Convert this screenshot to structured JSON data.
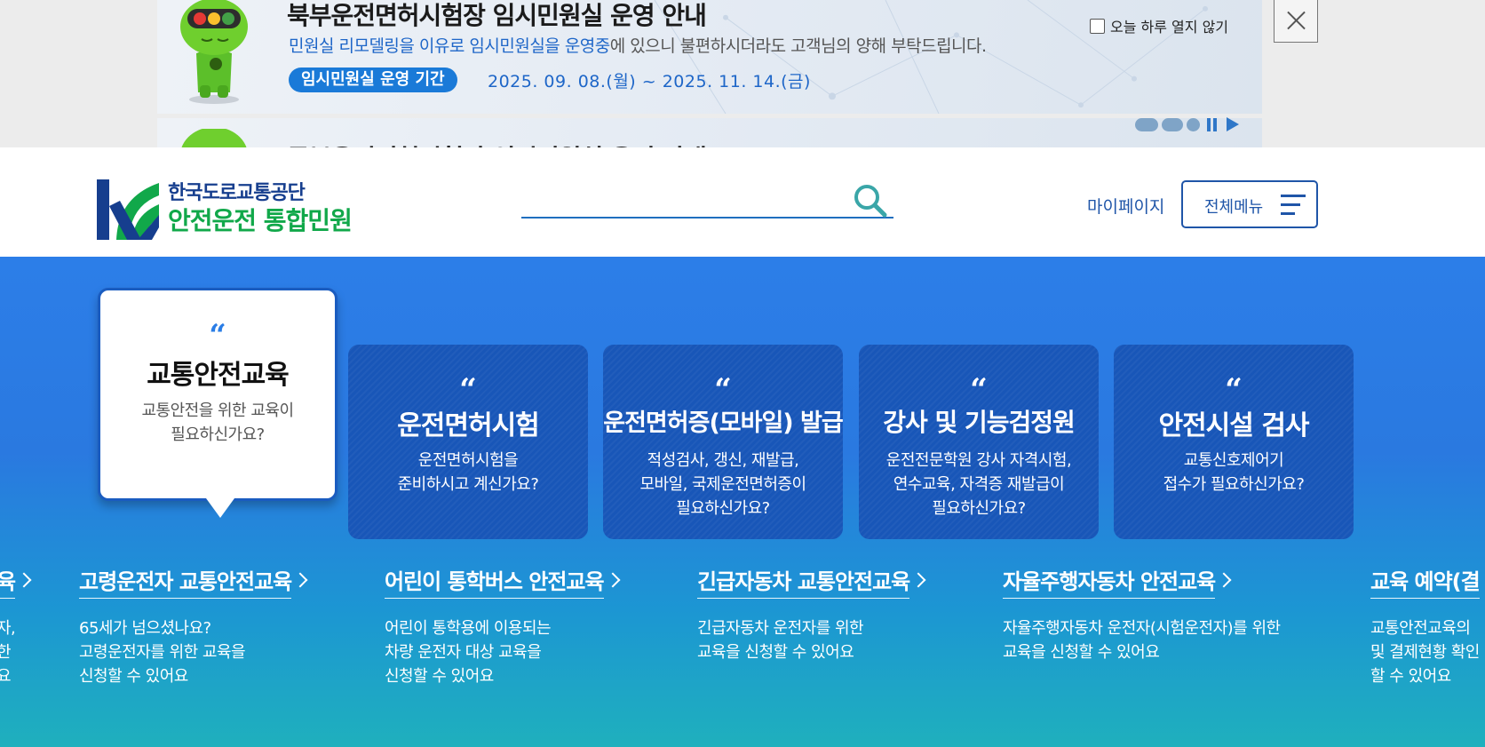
{
  "popup": {
    "slide1": {
      "title": "북부운전면허시험장 임시민원실 운영 안내",
      "desc_highlight": "민원실 리모델링을 이유로 임시민원실을 운영중",
      "desc_rest": "에 있으니 불편하시더라도 고객님의 양해 부탁드립니다.",
      "period_label": "임시민원실 운영 기간",
      "period_value": "2025. 09. 08.(월) ~ 2025. 11. 14.(금)"
    },
    "slide2": {
      "title": "동부운전면허시험장 임시민원실 운영 안내"
    },
    "no_today_label": "오늘 하루 열지 않기",
    "close_icon": "close-icon",
    "pager": {
      "slide_count": 3,
      "active_index": 0
    }
  },
  "header": {
    "logo_line1": "한국도로교통공단",
    "logo_line2": "안전운전 통합민원",
    "search_value": "",
    "mypage_label": "마이페이지",
    "allmenu_label": "전체메뉴"
  },
  "service_cards": [
    {
      "title": "교통안전교육",
      "desc": "교통안전을 위한 교육이\n필요하신가요?",
      "active": true
    },
    {
      "title": "운전면허시험",
      "desc": "운전면허시험을\n준비하시고 계신가요?",
      "active": false
    },
    {
      "title": "운전면허증(모바일) 발급",
      "desc": "적성검사, 갱신, 재발급,\n모바일, 국제운전면허증이\n필요하신가요?",
      "active": false
    },
    {
      "title": "강사 및 기능검정원",
      "desc": "운전전문학원 강사 자격시험,\n연수교육, 자격증 재발급이\n필요하신가요?",
      "active": false
    },
    {
      "title": "안전시설 검사",
      "desc": "교통신호제어기\n접수가 필요하신가요?",
      "active": false
    }
  ],
  "quote_mark": "“",
  "sub_services": [
    {
      "title": "육",
      "desc": "자,\n한\n요"
    },
    {
      "title": "고령운전자 교통안전교육",
      "desc": "65세가 넘으셨나요?\n고령운전자를 위한 교육을\n신청할 수 있어요"
    },
    {
      "title": "어린이 통학버스 안전교육",
      "desc": "어린이 통학용에 이용되는\n차량 운전자 대상 교육을\n신청할 수 있어요"
    },
    {
      "title": "긴급자동차 교통안전교육",
      "desc": "긴급자동차 운전자를 위한\n교육을 신청할 수 있어요"
    },
    {
      "title": "자율주행자동차 안전교육",
      "desc": "자율주행자동차 운전자(시험운전자)를 위한\n교육을 신청할 수 있어요"
    },
    {
      "title": "교육 예약(결",
      "desc": "교통안전교육의\n및 결제현황 확인\n할 수 있어요"
    }
  ],
  "colors": {
    "brand_navy": "#163e8e",
    "brand_green": "#11a84a",
    "accent_blue": "#1f55a8",
    "card_blue": "#1856b8"
  }
}
